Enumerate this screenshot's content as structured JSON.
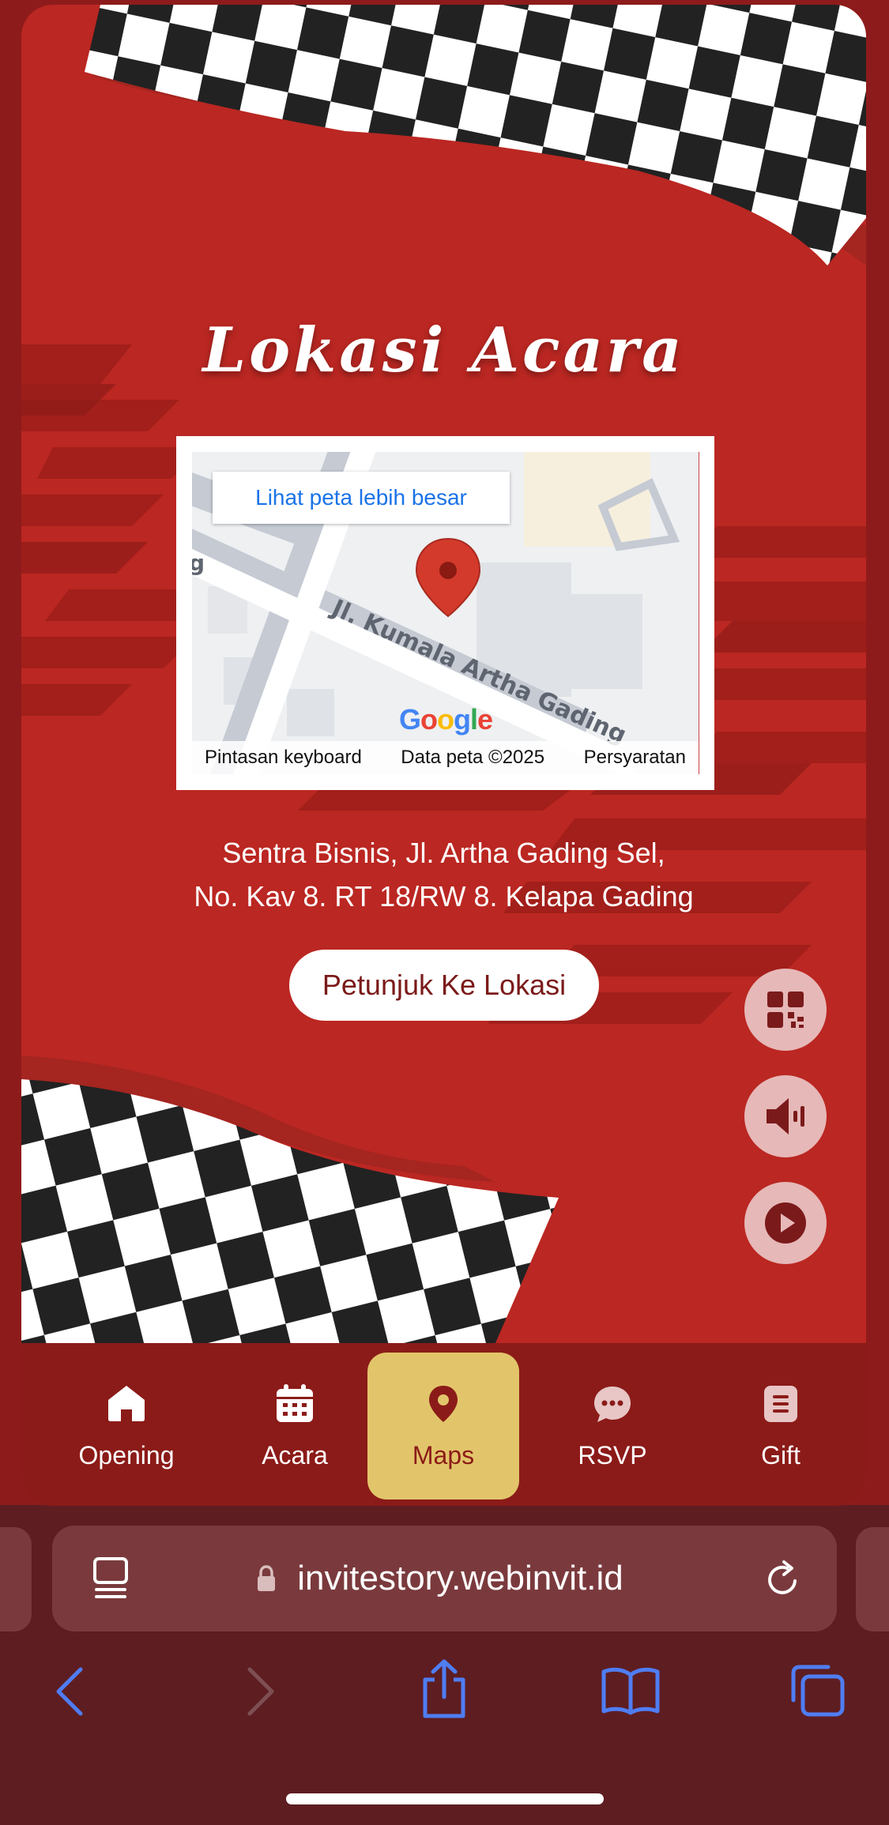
{
  "section": {
    "title": "Lokasi Acara",
    "address_line1": "Sentra Bisnis, Jl. Artha Gading Sel,",
    "address_line2": "No. Kav 8. RT 18/RW 8. Kelapa Gading",
    "directions_label": "Petunjuk Ke Lokasi"
  },
  "map": {
    "view_larger_label": "Lihat peta lebih besar",
    "street_label": "Jl. Kumala Artha Gading",
    "logo_text": "Google",
    "footer": {
      "keyboard": "Pintasan keyboard",
      "data": "Data peta ©2025",
      "terms": "Persyaratan"
    }
  },
  "floating_buttons": [
    {
      "icon": "qr-code-icon"
    },
    {
      "icon": "speaker-icon"
    },
    {
      "icon": "play-icon"
    }
  ],
  "bottom_nav": {
    "items": [
      {
        "label": "Opening",
        "icon": "home-icon"
      },
      {
        "label": "Acara",
        "icon": "calendar-icon"
      },
      {
        "label": "Maps",
        "icon": "map-pin-icon",
        "active": true
      },
      {
        "label": "RSVP",
        "icon": "chat-icon"
      },
      {
        "label": "Gift",
        "icon": "gift-list-icon"
      }
    ]
  },
  "browser": {
    "url": "invitestory.webinvit.id"
  },
  "colors": {
    "background_red": "#bb2722",
    "nav_dark_red": "#8b1b18",
    "active_gold": "#e2c56a",
    "browser_chrome": "#5e1d21",
    "link_blue": "#1a73e8"
  }
}
